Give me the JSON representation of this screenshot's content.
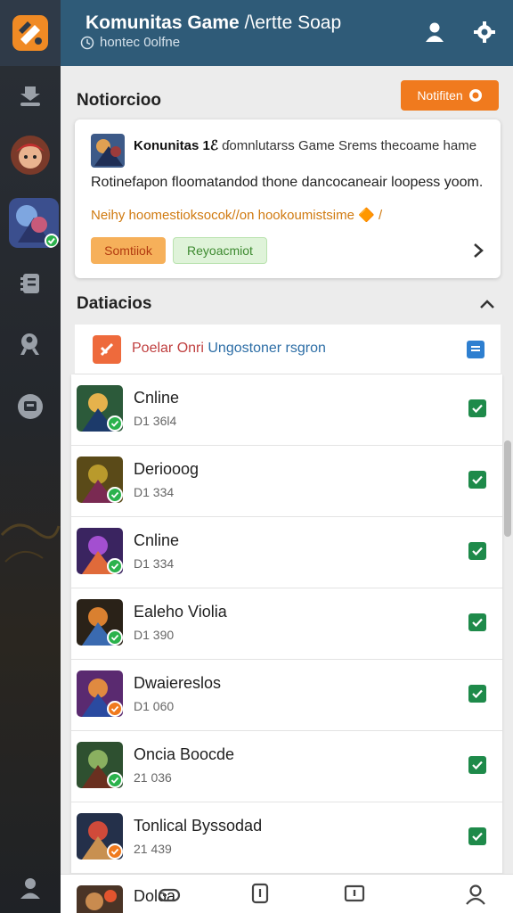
{
  "header": {
    "title_bold": "Komunitas Game",
    "title_rest": " /\\ertte Soap",
    "subtitle": "hontec 0olfne"
  },
  "notifications": {
    "section_title": "Notiorcioo",
    "button_label": "Notifiten"
  },
  "card": {
    "title_bold": "Konunitas 1ℰ",
    "title_rest": " ɗomnlutarss Game Srems thecoame hame",
    "description": "Rotinefapon floomatandod thone dancocaneair loopess yoom.",
    "link": "Neihy hoomestioksocok//on hookoumistsime 🔶 /",
    "chip_a": "Somtiiok",
    "chip_b": "Reyoacmiot"
  },
  "details": {
    "section_title": "Datiacios",
    "feature_label_red": "Poelar Onri ",
    "feature_label_blue": "Ungostoner rsgron"
  },
  "rows": [
    {
      "name": "Cnline",
      "meta": "D1 36l4",
      "badge": "green"
    },
    {
      "name": "Deriooog",
      "meta": "D1 334",
      "badge": "green"
    },
    {
      "name": "Cnline",
      "meta": "D1 334",
      "badge": "green"
    },
    {
      "name": "Ealeho Violia",
      "meta": "D1 390",
      "badge": "green"
    },
    {
      "name": "Dwaiereslos",
      "meta": "D1 060",
      "badge": "orange"
    },
    {
      "name": "Oncia Boocde",
      "meta": "21 036",
      "badge": "green"
    },
    {
      "name": "Tonlical Byssodad",
      "meta": "21 439",
      "badge": "orange"
    }
  ],
  "bottom": {
    "peek_name": "Doloa"
  },
  "colors": {
    "header": "#2f5b78",
    "accent": "#f07a1e",
    "check": "#1e8a4a"
  }
}
